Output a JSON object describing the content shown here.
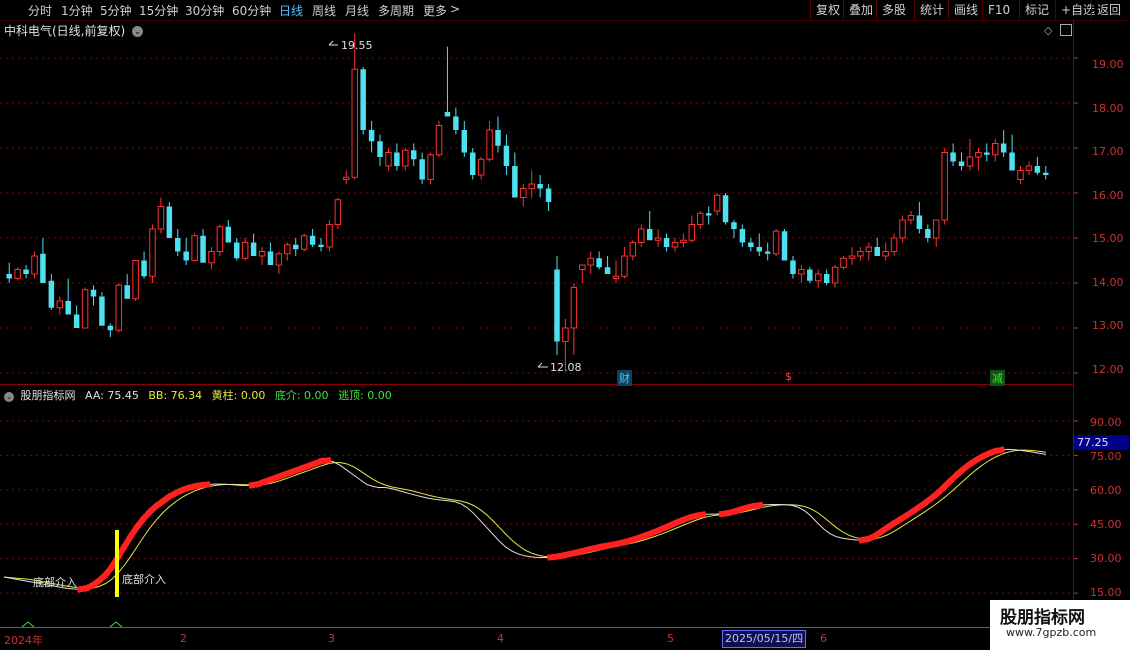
{
  "toolbar": {
    "timeframes": [
      {
        "label": "分时",
        "active": false
      },
      {
        "label": "1分钟",
        "active": false
      },
      {
        "label": "5分钟",
        "active": false
      },
      {
        "label": "15分钟",
        "active": false
      },
      {
        "label": "30分钟",
        "active": false
      },
      {
        "label": "60分钟",
        "active": false
      },
      {
        "label": "日线",
        "active": true
      },
      {
        "label": "周线",
        "active": false
      },
      {
        "label": "月线",
        "active": false
      },
      {
        "label": "多周期",
        "active": false
      },
      {
        "label": "更多",
        "active": false
      }
    ],
    "buttons": [
      "复权",
      "叠加",
      "多股",
      "统计",
      "画线",
      "F10",
      "标记",
      "+自选",
      "返回"
    ]
  },
  "chart_title": "中科电气(日线,前复权)",
  "price_axis": [
    "19.00",
    "18.00",
    "17.00",
    "16.00",
    "15.00",
    "14.00",
    "13.00",
    "12.00"
  ],
  "price_high_label": "19.55",
  "price_low_label": "12.08",
  "events": [
    {
      "text": "财",
      "color": "#4fc3f7"
    },
    {
      "text": "$",
      "color": "#ff4040"
    },
    {
      "text": "减",
      "color": "#40e040"
    }
  ],
  "indicator": {
    "name": "股朋指标网",
    "items": [
      {
        "text": "AA: 75.45",
        "color": "#e0e0e0"
      },
      {
        "text": "BB: 76.34",
        "color": "#e8e840"
      },
      {
        "text": "黄柱: 0.00",
        "color": "#e8e840"
      },
      {
        "text": "底介: 0.00",
        "color": "#40e040"
      },
      {
        "text": "逃顶: 0.00",
        "color": "#40e040"
      }
    ],
    "axis": [
      "90.00",
      "75.00",
      "60.00",
      "45.00",
      "30.00",
      "15.00"
    ],
    "current": "77.25",
    "signal_labels": [
      "底部介入",
      "底部介入"
    ]
  },
  "x_axis": [
    "2024年",
    "2",
    "3",
    "4",
    "5",
    "6"
  ],
  "x_highlight": "2025/05/15/四",
  "watermark": {
    "title": "股朋指标网",
    "url": "www.7gpzb.com"
  },
  "colors": {
    "up": "#ff3030",
    "down": "#4fe0f0",
    "grid": "#8b0000",
    "aa": "#e0e0e0",
    "bb": "#e8e840"
  },
  "chart_data": {
    "type": "candlestick",
    "candles": [
      [
        14.2,
        14.45,
        14.0,
        14.1
      ],
      [
        14.1,
        14.35,
        14.05,
        14.3
      ],
      [
        14.3,
        14.4,
        14.1,
        14.2
      ],
      [
        14.2,
        14.7,
        14.1,
        14.6
      ],
      [
        14.65,
        15.0,
        14.3,
        14.0
      ],
      [
        14.05,
        14.2,
        13.4,
        13.45
      ],
      [
        13.45,
        13.7,
        13.3,
        13.6
      ],
      [
        13.6,
        14.1,
        13.5,
        13.3
      ],
      [
        13.3,
        13.5,
        13.0,
        13.0
      ],
      [
        13.0,
        13.9,
        13.0,
        13.85
      ],
      [
        13.85,
        13.95,
        13.5,
        13.7
      ],
      [
        13.7,
        13.8,
        13.2,
        13.05
      ],
      [
        13.05,
        13.1,
        12.8,
        12.95
      ],
      [
        12.95,
        14.0,
        12.9,
        13.95
      ],
      [
        13.95,
        14.2,
        13.9,
        13.65
      ],
      [
        13.65,
        14.5,
        13.6,
        14.5
      ],
      [
        14.5,
        14.7,
        14.1,
        14.15
      ],
      [
        14.15,
        15.3,
        14.0,
        15.2
      ],
      [
        15.2,
        15.9,
        15.1,
        15.7
      ],
      [
        15.7,
        15.8,
        15.2,
        15.0
      ],
      [
        15.0,
        15.2,
        14.6,
        14.7
      ],
      [
        14.7,
        15.0,
        14.4,
        14.5
      ],
      [
        14.5,
        15.1,
        14.5,
        15.05
      ],
      [
        15.05,
        15.2,
        14.6,
        14.45
      ],
      [
        14.45,
        14.8,
        14.3,
        14.7
      ],
      [
        14.7,
        15.3,
        14.6,
        15.25
      ],
      [
        15.25,
        15.4,
        14.9,
        14.9
      ],
      [
        14.9,
        15.0,
        14.5,
        14.55
      ],
      [
        14.55,
        15.0,
        14.5,
        14.9
      ],
      [
        14.9,
        15.1,
        14.6,
        14.6
      ],
      [
        14.6,
        14.8,
        14.4,
        14.7
      ],
      [
        14.7,
        14.9,
        14.5,
        14.4
      ],
      [
        14.4,
        14.7,
        14.2,
        14.65
      ],
      [
        14.65,
        14.9,
        14.5,
        14.85
      ],
      [
        14.85,
        15.0,
        14.6,
        14.75
      ],
      [
        14.75,
        15.1,
        14.7,
        15.05
      ],
      [
        15.05,
        15.2,
        14.8,
        14.85
      ],
      [
        14.85,
        15.0,
        14.7,
        14.8
      ],
      [
        14.8,
        15.4,
        14.7,
        15.3
      ],
      [
        15.3,
        15.9,
        15.2,
        15.85
      ],
      [
        16.3,
        16.5,
        16.2,
        16.35
      ],
      [
        16.35,
        19.55,
        16.3,
        18.75
      ],
      [
        18.75,
        18.8,
        17.3,
        17.4
      ],
      [
        17.4,
        17.6,
        16.9,
        17.15
      ],
      [
        17.15,
        17.3,
        16.6,
        16.8
      ],
      [
        16.6,
        17.0,
        16.5,
        16.9
      ],
      [
        16.9,
        17.1,
        16.5,
        16.6
      ],
      [
        16.6,
        17.0,
        16.5,
        16.95
      ],
      [
        16.95,
        17.1,
        16.6,
        16.75
      ],
      [
        16.75,
        16.9,
        16.2,
        16.3
      ],
      [
        16.3,
        16.9,
        16.2,
        16.85
      ],
      [
        16.85,
        17.6,
        16.8,
        17.5
      ],
      [
        17.8,
        19.25,
        17.7,
        17.7
      ],
      [
        17.7,
        17.9,
        17.3,
        17.4
      ],
      [
        17.4,
        17.6,
        16.8,
        16.9
      ],
      [
        16.9,
        17.0,
        16.3,
        16.4
      ],
      [
        16.4,
        16.8,
        16.3,
        16.75
      ],
      [
        16.75,
        17.6,
        16.7,
        17.4
      ],
      [
        17.4,
        17.7,
        16.9,
        17.05
      ],
      [
        17.05,
        17.3,
        16.4,
        16.6
      ],
      [
        16.6,
        16.9,
        16.0,
        15.9
      ],
      [
        15.9,
        16.2,
        15.7,
        16.1
      ],
      [
        16.1,
        16.5,
        15.9,
        16.2
      ],
      [
        16.2,
        16.4,
        15.9,
        16.1
      ],
      [
        16.1,
        16.2,
        15.6,
        15.8
      ],
      [
        14.3,
        14.6,
        12.4,
        12.7
      ],
      [
        12.7,
        13.2,
        12.08,
        13.0
      ],
      [
        13.0,
        14.0,
        12.4,
        13.9
      ],
      [
        14.3,
        14.4,
        14.0,
        14.4
      ],
      [
        14.4,
        14.7,
        14.2,
        14.55
      ],
      [
        14.55,
        14.7,
        14.3,
        14.35
      ],
      [
        14.35,
        14.6,
        14.2,
        14.2
      ],
      [
        14.1,
        14.5,
        14.0,
        14.15
      ],
      [
        14.15,
        14.8,
        14.1,
        14.6
      ],
      [
        14.6,
        14.95,
        14.5,
        14.9
      ],
      [
        14.9,
        15.3,
        14.8,
        15.2
      ],
      [
        15.2,
        15.6,
        15.1,
        14.95
      ],
      [
        14.95,
        15.2,
        14.8,
        15.0
      ],
      [
        15.0,
        15.1,
        14.7,
        14.8
      ],
      [
        14.8,
        15.0,
        14.7,
        14.9
      ],
      [
        14.9,
        15.1,
        14.8,
        14.95
      ],
      [
        14.95,
        15.5,
        14.9,
        15.3
      ],
      [
        15.3,
        15.6,
        15.2,
        15.55
      ],
      [
        15.55,
        15.7,
        15.3,
        15.5
      ],
      [
        15.6,
        16.0,
        15.5,
        15.95
      ],
      [
        15.95,
        16.0,
        15.3,
        15.35
      ],
      [
        15.35,
        15.4,
        15.0,
        15.2
      ],
      [
        15.2,
        15.3,
        14.8,
        14.9
      ],
      [
        14.9,
        15.0,
        14.7,
        14.8
      ],
      [
        14.8,
        15.1,
        14.6,
        14.7
      ],
      [
        14.7,
        14.9,
        14.5,
        14.65
      ],
      [
        14.65,
        15.2,
        14.6,
        15.15
      ],
      [
        15.15,
        15.2,
        14.5,
        14.5
      ],
      [
        14.5,
        14.6,
        14.1,
        14.2
      ],
      [
        14.2,
        14.4,
        14.0,
        14.3
      ],
      [
        14.3,
        14.35,
        14.0,
        14.05
      ],
      [
        14.05,
        14.3,
        13.9,
        14.2
      ],
      [
        14.2,
        14.3,
        13.95,
        14.0
      ],
      [
        14.0,
        14.4,
        13.9,
        14.35
      ],
      [
        14.35,
        14.6,
        14.3,
        14.55
      ],
      [
        14.55,
        14.8,
        14.4,
        14.6
      ],
      [
        14.6,
        14.8,
        14.5,
        14.7
      ],
      [
        14.7,
        14.9,
        14.5,
        14.8
      ],
      [
        14.8,
        15.0,
        14.6,
        14.6
      ],
      [
        14.6,
        14.9,
        14.5,
        14.7
      ],
      [
        14.7,
        15.1,
        14.6,
        15.0
      ],
      [
        15.0,
        15.5,
        14.9,
        15.4
      ],
      [
        15.4,
        15.6,
        15.3,
        15.5
      ],
      [
        15.5,
        15.8,
        15.1,
        15.2
      ],
      [
        15.2,
        15.3,
        14.9,
        15.0
      ],
      [
        15.0,
        15.2,
        14.8,
        15.4
      ],
      [
        15.4,
        17.0,
        15.3,
        16.9
      ],
      [
        16.9,
        17.1,
        16.6,
        16.7
      ],
      [
        16.7,
        16.9,
        16.5,
        16.6
      ],
      [
        16.6,
        17.2,
        16.5,
        16.8
      ],
      [
        16.8,
        17.0,
        16.5,
        16.9
      ],
      [
        16.9,
        17.1,
        16.7,
        16.85
      ],
      [
        16.85,
        17.2,
        16.7,
        17.1
      ],
      [
        17.1,
        17.4,
        16.8,
        16.9
      ],
      [
        16.9,
        17.3,
        16.6,
        16.5
      ],
      [
        16.3,
        16.6,
        16.2,
        16.5
      ],
      [
        16.5,
        16.7,
        16.4,
        16.6
      ],
      [
        16.6,
        16.8,
        16.4,
        16.45
      ],
      [
        16.45,
        16.6,
        16.3,
        16.4
      ]
    ],
    "aa": [
      22,
      21.5,
      21,
      20.5,
      20,
      19.5,
      19,
      18.5,
      18,
      17.5,
      17,
      16.8,
      16.7,
      17.2,
      18.5,
      20.5,
      23,
      26.5,
      31,
      35.5,
      40,
      44,
      47.5,
      50.5,
      53,
      55,
      57,
      58.5,
      59.8,
      60.8,
      61.5,
      62,
      62.3,
      62.5,
      62.5,
      62.4,
      62.2,
      62.0,
      61.9,
      62.0,
      62.5,
      63.5,
      64.5,
      65.5,
      66.5,
      67.5,
      68.5,
      69.5,
      70.5,
      71.5,
      72.5,
      72.8,
      72.0,
      70.5,
      68.5,
      66.5,
      64.5,
      62.5,
      61.5,
      61.0,
      61.0,
      60.5,
      59.8,
      59.0,
      58.2,
      57.5,
      56.8,
      56.2,
      55.8,
      55.5,
      55.2,
      54.8,
      53.8,
      52.0,
      49.5,
      46.5,
      43.5,
      40.5,
      37.5,
      35.0,
      33.2,
      32.0,
      31.2,
      30.8,
      30.5,
      30.5,
      30.6,
      30.9,
      31.4,
      32.0,
      32.6,
      33.3,
      34.0,
      34.6,
      35.2,
      35.7,
      36.2,
      36.8,
      37.5,
      38.3,
      39.2,
      40.2,
      41.2,
      42.3,
      43.5,
      44.7,
      45.9,
      47.0,
      48.0,
      48.7,
      49.2,
      49.4,
      49.4,
      49.5,
      49.9,
      50.6,
      51.5,
      52.3,
      52.9,
      53.3,
      53.5,
      53.6,
      53.6,
      53.5,
      53.2,
      52.4,
      50.9,
      48.6,
      45.7,
      43.0,
      40.9,
      39.6,
      38.9,
      38.5,
      38.2,
      38.1,
      38.6,
      39.8,
      41.6,
      43.5,
      45.3,
      47.0,
      48.7,
      50.5,
      52.4,
      54.3,
      56.4,
      58.7,
      61.3,
      64.0,
      66.6,
      69.0,
      71.1,
      72.9,
      74.5,
      75.8,
      76.8,
      77.4,
      77.6,
      77.5,
      77.2,
      76.8,
      76.4,
      75.9,
      75.45
    ],
    "ylim_price": [
      11.8,
      19.8
    ],
    "ylim_indicator": [
      12,
      100
    ]
  }
}
